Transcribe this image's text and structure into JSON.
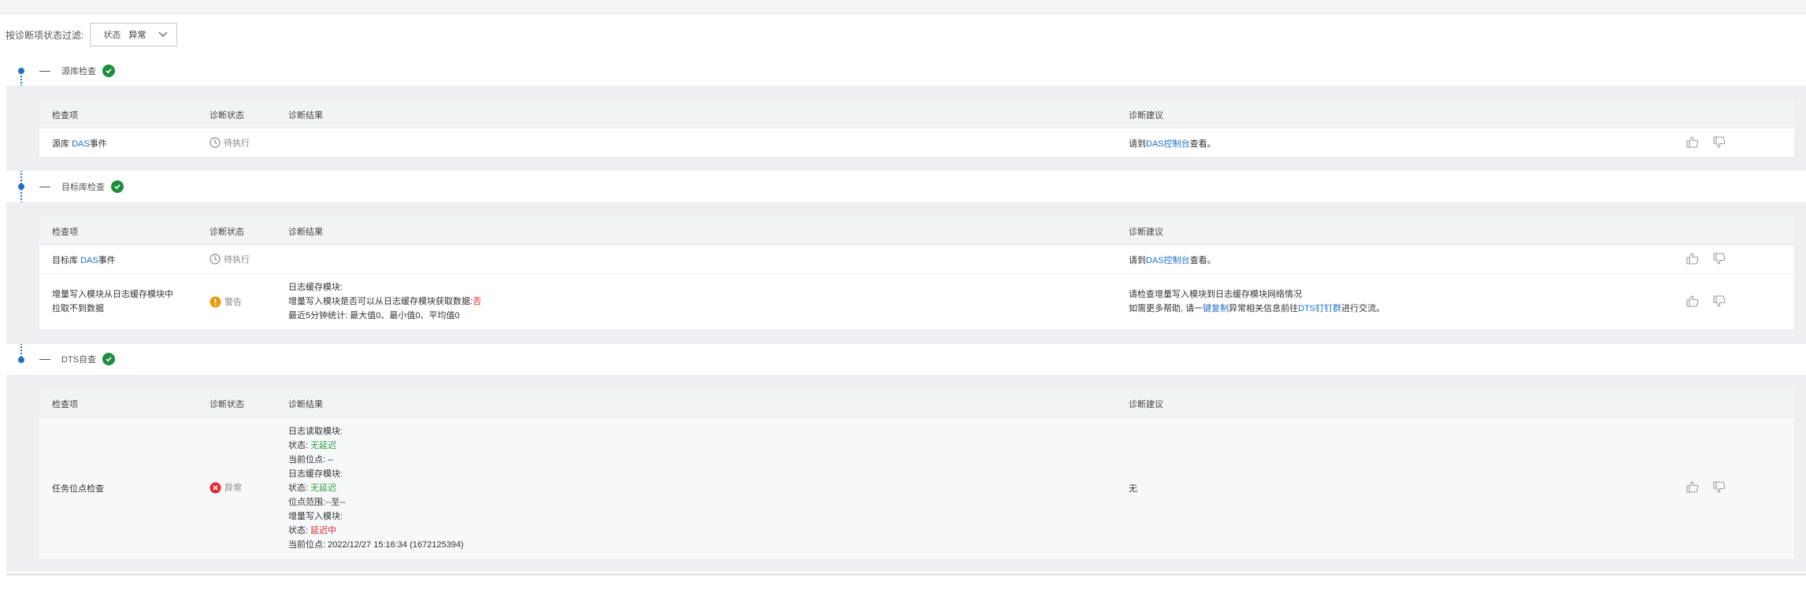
{
  "filter": {
    "label": "按诊断项状态过滤:",
    "select_prefix": "状态",
    "select_value": "异常"
  },
  "headers": {
    "item": "检查项",
    "status": "诊断状态",
    "result": "诊断结果",
    "advice": "诊断建议"
  },
  "sections": [
    {
      "title": "源库检查",
      "rows": [
        {
          "item_prefix": "源库 ",
          "item_link": "DAS",
          "item_suffix": "事件",
          "status": "待执行",
          "advice_prefix": "请到",
          "advice_link": "DAS控制台",
          "advice_suffix": "查看。"
        }
      ]
    },
    {
      "title": "目标库检查",
      "rows": [
        {
          "item_prefix": "目标库 ",
          "item_link": "DAS",
          "item_suffix": "事件",
          "status": "待执行",
          "advice_prefix": "请到",
          "advice_link": "DAS控制台",
          "advice_suffix": "查看。"
        },
        {
          "item_line1": "增量写入模块从日志缓存模块中",
          "item_line2": "拉取不到数据",
          "status": "警告",
          "result_line1": "日志缓存模块:",
          "result_line2_prefix": "增量写入模块是否可以从日志缓存模块获取数据:",
          "result_line2_value": "否",
          "result_line3": "最近5分钟统计: 最大值0、最小值0、平均值0",
          "advice_line1": "请检查增量写入模块到日志缓存模块网络情况",
          "advice_line2_a": "如需更多帮助, 请一",
          "advice_line2_link1": "键复制",
          "advice_line2_b": "异常相关信息前往",
          "advice_line2_link2": "DTS钉钉群",
          "advice_line2_c": "进行交流。"
        }
      ]
    },
    {
      "title": "DTS自查",
      "rows": [
        {
          "item": "任务位点检查",
          "status": "异常",
          "result": [
            {
              "label": "日志读取模块:",
              "value": "",
              "color": ""
            },
            {
              "label": "状态: ",
              "value": "无延迟",
              "color": "green"
            },
            {
              "label": "当前位点: --",
              "value": "",
              "color": ""
            },
            {
              "label": "日志缓存模块:",
              "value": "",
              "color": ""
            },
            {
              "label": "状态: ",
              "value": "无延迟",
              "color": "green"
            },
            {
              "label": "位点范围:--至--",
              "value": "",
              "color": ""
            },
            {
              "label": "增量写入模块:",
              "value": "",
              "color": ""
            },
            {
              "label": "状态: ",
              "value": "延迟中",
              "color": "red"
            },
            {
              "label": "当前位点: 2022/12/27 15:16:34 (1672125394)",
              "value": "",
              "color": ""
            }
          ],
          "advice": "无"
        }
      ]
    }
  ],
  "colors": {
    "accent": "#1f6fc5",
    "success": "#1e8e3e",
    "warning": "#e59b11",
    "danger": "#e0282e"
  }
}
